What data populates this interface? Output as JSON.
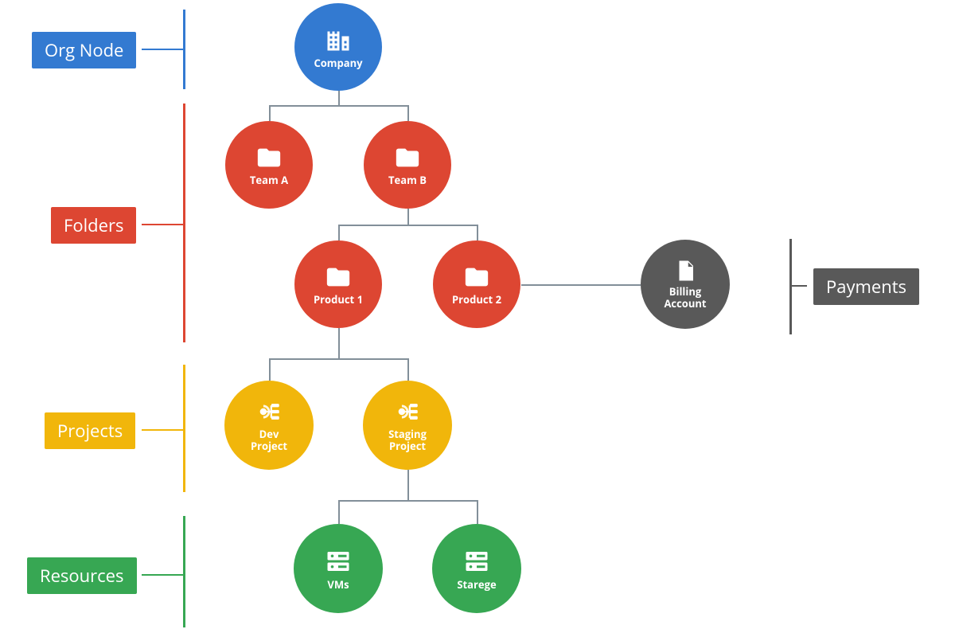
{
  "legend": {
    "org": "Org Node",
    "folders": "Folders",
    "projects": "Projects",
    "resources": "Resources",
    "payments": "Payments"
  },
  "nodes": {
    "company": "Company",
    "teamA": "Team A",
    "teamB": "Team B",
    "product1": "Product 1",
    "product2": "Product 2",
    "devProject": "Dev\nProject",
    "stagingProject": "Staging\nProject",
    "vms": "VMs",
    "storage": "Starege",
    "billing": "Billing\nAccount"
  },
  "colors": {
    "blue": "#337ad1",
    "red": "#dd4632",
    "yellow": "#f1b60b",
    "green": "#37a753",
    "grey": "#595959",
    "connector": "#828f99"
  }
}
